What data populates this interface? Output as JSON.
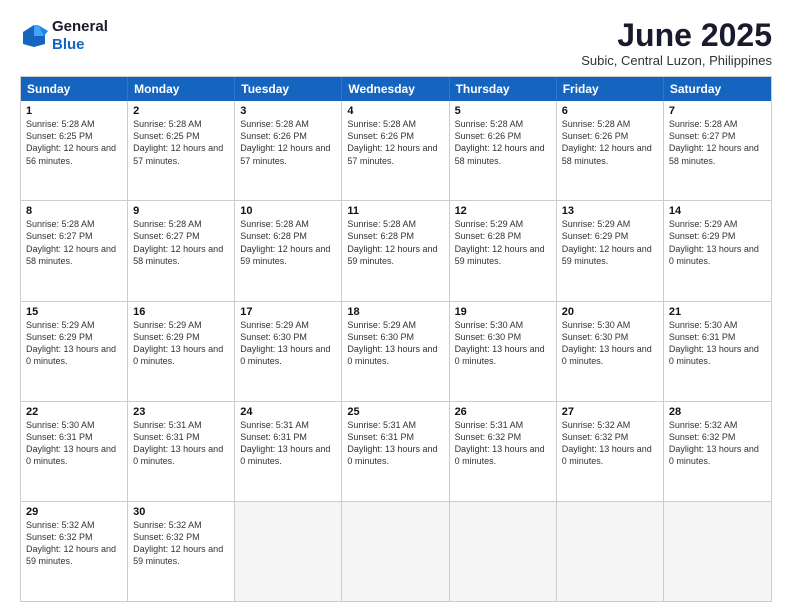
{
  "header": {
    "logo_line1": "General",
    "logo_line2": "Blue",
    "month_title": "June 2025",
    "location": "Subic, Central Luzon, Philippines"
  },
  "weekdays": [
    "Sunday",
    "Monday",
    "Tuesday",
    "Wednesday",
    "Thursday",
    "Friday",
    "Saturday"
  ],
  "rows": [
    [
      {
        "day": "",
        "empty": true
      },
      {
        "day": "2",
        "sunrise": "5:28 AM",
        "sunset": "6:25 PM",
        "daylight": "12 hours and 57 minutes."
      },
      {
        "day": "3",
        "sunrise": "5:28 AM",
        "sunset": "6:26 PM",
        "daylight": "12 hours and 57 minutes."
      },
      {
        "day": "4",
        "sunrise": "5:28 AM",
        "sunset": "6:26 PM",
        "daylight": "12 hours and 57 minutes."
      },
      {
        "day": "5",
        "sunrise": "5:28 AM",
        "sunset": "6:26 PM",
        "daylight": "12 hours and 58 minutes."
      },
      {
        "day": "6",
        "sunrise": "5:28 AM",
        "sunset": "6:26 PM",
        "daylight": "12 hours and 58 minutes."
      },
      {
        "day": "7",
        "sunrise": "5:28 AM",
        "sunset": "6:27 PM",
        "daylight": "12 hours and 58 minutes."
      }
    ],
    [
      {
        "day": "8",
        "sunrise": "5:28 AM",
        "sunset": "6:27 PM",
        "daylight": "12 hours and 58 minutes."
      },
      {
        "day": "9",
        "sunrise": "5:28 AM",
        "sunset": "6:27 PM",
        "daylight": "12 hours and 58 minutes."
      },
      {
        "day": "10",
        "sunrise": "5:28 AM",
        "sunset": "6:28 PM",
        "daylight": "12 hours and 59 minutes."
      },
      {
        "day": "11",
        "sunrise": "5:28 AM",
        "sunset": "6:28 PM",
        "daylight": "12 hours and 59 minutes."
      },
      {
        "day": "12",
        "sunrise": "5:29 AM",
        "sunset": "6:28 PM",
        "daylight": "12 hours and 59 minutes."
      },
      {
        "day": "13",
        "sunrise": "5:29 AM",
        "sunset": "6:29 PM",
        "daylight": "12 hours and 59 minutes."
      },
      {
        "day": "14",
        "sunrise": "5:29 AM",
        "sunset": "6:29 PM",
        "daylight": "13 hours and 0 minutes."
      }
    ],
    [
      {
        "day": "15",
        "sunrise": "5:29 AM",
        "sunset": "6:29 PM",
        "daylight": "13 hours and 0 minutes."
      },
      {
        "day": "16",
        "sunrise": "5:29 AM",
        "sunset": "6:29 PM",
        "daylight": "13 hours and 0 minutes."
      },
      {
        "day": "17",
        "sunrise": "5:29 AM",
        "sunset": "6:30 PM",
        "daylight": "13 hours and 0 minutes."
      },
      {
        "day": "18",
        "sunrise": "5:29 AM",
        "sunset": "6:30 PM",
        "daylight": "13 hours and 0 minutes."
      },
      {
        "day": "19",
        "sunrise": "5:30 AM",
        "sunset": "6:30 PM",
        "daylight": "13 hours and 0 minutes."
      },
      {
        "day": "20",
        "sunrise": "5:30 AM",
        "sunset": "6:30 PM",
        "daylight": "13 hours and 0 minutes."
      },
      {
        "day": "21",
        "sunrise": "5:30 AM",
        "sunset": "6:31 PM",
        "daylight": "13 hours and 0 minutes."
      }
    ],
    [
      {
        "day": "22",
        "sunrise": "5:30 AM",
        "sunset": "6:31 PM",
        "daylight": "13 hours and 0 minutes."
      },
      {
        "day": "23",
        "sunrise": "5:31 AM",
        "sunset": "6:31 PM",
        "daylight": "13 hours and 0 minutes."
      },
      {
        "day": "24",
        "sunrise": "5:31 AM",
        "sunset": "6:31 PM",
        "daylight": "13 hours and 0 minutes."
      },
      {
        "day": "25",
        "sunrise": "5:31 AM",
        "sunset": "6:31 PM",
        "daylight": "13 hours and 0 minutes."
      },
      {
        "day": "26",
        "sunrise": "5:31 AM",
        "sunset": "6:32 PM",
        "daylight": "13 hours and 0 minutes."
      },
      {
        "day": "27",
        "sunrise": "5:32 AM",
        "sunset": "6:32 PM",
        "daylight": "13 hours and 0 minutes."
      },
      {
        "day": "28",
        "sunrise": "5:32 AM",
        "sunset": "6:32 PM",
        "daylight": "13 hours and 0 minutes."
      }
    ],
    [
      {
        "day": "29",
        "sunrise": "5:32 AM",
        "sunset": "6:32 PM",
        "daylight": "12 hours and 59 minutes."
      },
      {
        "day": "30",
        "sunrise": "5:32 AM",
        "sunset": "6:32 PM",
        "daylight": "12 hours and 59 minutes."
      },
      {
        "day": "",
        "empty": true
      },
      {
        "day": "",
        "empty": true
      },
      {
        "day": "",
        "empty": true
      },
      {
        "day": "",
        "empty": true
      },
      {
        "day": "",
        "empty": true
      }
    ]
  ],
  "row0_day1": {
    "day": "1",
    "sunrise": "5:28 AM",
    "sunset": "6:25 PM",
    "daylight": "12 hours and 56 minutes."
  }
}
